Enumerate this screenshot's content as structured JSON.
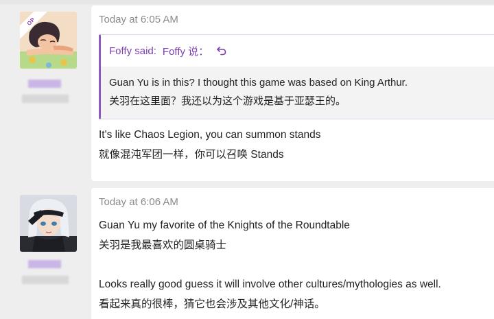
{
  "posts": [
    {
      "avatar_icon": "anime-girl-lying-avatar",
      "badge": "OP",
      "timestamp": "Today at 6:05 AM",
      "quote": {
        "header": "Foffy said:",
        "header_translation": "Foffy 说：",
        "reply_icon": "reply-arrow-icon",
        "lines": [
          "Guan Yu is in this? I thought this game was based on King Arthur.",
          "关羽在这里面？我还以为这个游戏是基于亚瑟王的。"
        ]
      },
      "message_lines": [
        "It's like Chaos Legion, you can summon stands",
        "就像混沌军团一样，你可以召唤 Stands"
      ]
    },
    {
      "avatar_icon": "white-haired-saluting-girl-avatar",
      "timestamp": "Today at 6:06 AM",
      "paragraph1": [
        "Guan Yu my favorite of the Knights of the Roundtable",
        "关羽是我最喜欢的圆桌骑士"
      ],
      "paragraph2": [
        "Looks really good guess it will involve other cultures/mythologies as well.",
        "看起来真的很棒，猜它也会涉及其他文化/神话。"
      ]
    }
  ],
  "colors": {
    "accent": "#7b3fb2",
    "page_background": "#eeeeee",
    "card_background": "#ffffff",
    "quote_background": "#f3f3f3"
  }
}
